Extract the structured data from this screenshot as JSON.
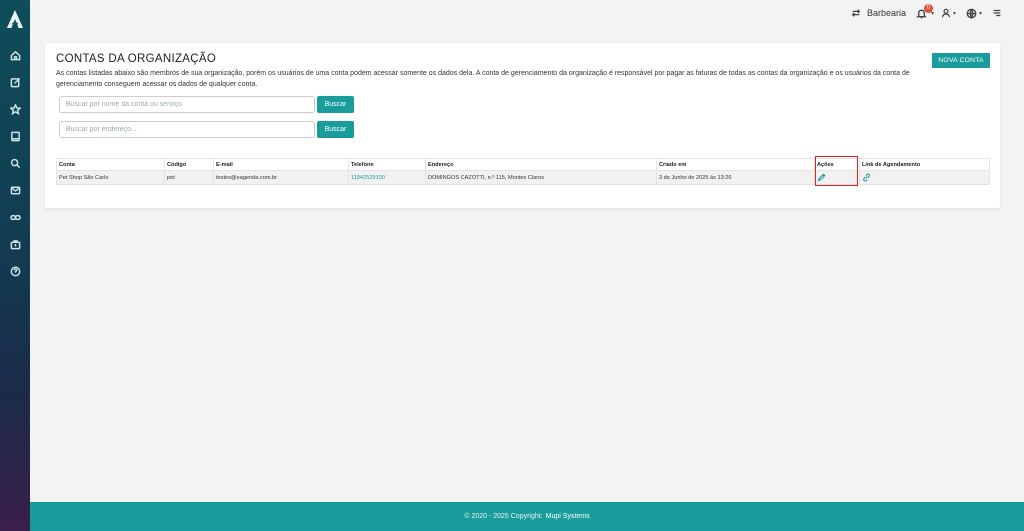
{
  "topbar": {
    "org_name": "Barbearia",
    "notification_count": "0"
  },
  "page": {
    "title": "CONTAS DA ORGANIZAÇÃO",
    "description": "As contas listadas abaixo são membros de sua organização, porém os usuários de uma conta podem acessar somente os dados dela. A conta de gerenciamento da organização é responsável por pagar as faturas de todas as contas da organização e os usuários da conta de gerenciamento conseguem acessar os dados de qualquer conta.",
    "new_account_label": "NOVA CONTA"
  },
  "search": {
    "name_placeholder": "Buscar por nome da conta ou serviço",
    "name_button": "Buscar",
    "address_placeholder": "Buscar por endereço...",
    "address_button": "Buscar"
  },
  "table": {
    "headers": [
      "Conta",
      "Código",
      "E-mail",
      "Telefone",
      "Endereço",
      "Criado em",
      "Ações",
      "Link de Agendamento"
    ],
    "rows": [
      {
        "conta": "Pet Shop São Carlo",
        "codigo": "pet",
        "email": "testes@eagenda.com.br",
        "telefone": "11942529100",
        "endereco": "DOMINGOS CAZOTTI, n.º 115, Montes Claros",
        "criado_em": "3 de Junho de 2025 às 13:26"
      }
    ]
  },
  "footer": {
    "copyright": "© 2020 - 2025 Copyright:",
    "brand": "Mupi Systems"
  },
  "icons": {
    "sidebar": [
      "home-icon",
      "edit-icon",
      "star-icon",
      "book-icon",
      "search-icon",
      "mail-icon",
      "link-icon",
      "briefcase-icon",
      "help-icon"
    ],
    "actions": "pencil-icon",
    "scheduling": "link-icon"
  },
  "colors": {
    "accent": "#1a9c9c",
    "highlight": "#e02020",
    "badge": "#e74c3c"
  }
}
